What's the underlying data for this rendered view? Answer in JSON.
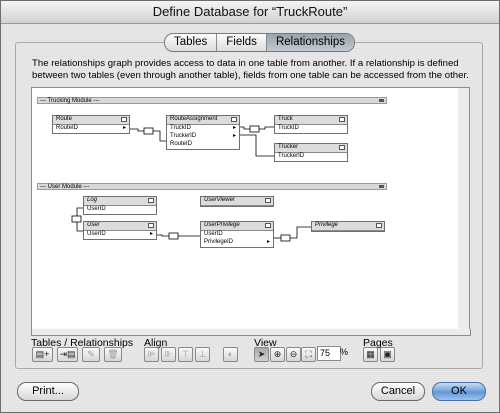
{
  "window": {
    "title": "Define Database for “TruckRoute”"
  },
  "tabs": [
    {
      "label": "Tables",
      "active": false
    },
    {
      "label": "Fields",
      "active": false
    },
    {
      "label": "Relationships",
      "active": true
    }
  ],
  "description": "The relationships graph provides access to data in one table from another. If a relationship is defined between two tables (even through another table), fields from one table can be accessed from the other.",
  "graph": {
    "modules": [
      {
        "label": "--- Trucking Module ---"
      },
      {
        "label": "--- User Module ---"
      }
    ],
    "tables": [
      {
        "name": "Route",
        "fields": [
          "RouteID"
        ],
        "italic": false
      },
      {
        "name": "RouteAssignment",
        "fields": [
          "TruckID",
          "TruckerID",
          "RouteID"
        ],
        "italic": false
      },
      {
        "name": "Truck",
        "fields": [
          "TruckID"
        ],
        "italic": false
      },
      {
        "name": "Trucker",
        "fields": [
          "TruckerID"
        ],
        "italic": false
      },
      {
        "name": "Log",
        "fields": [
          "UserID"
        ],
        "italic": true
      },
      {
        "name": "UserViewer",
        "fields": [],
        "italic": true
      },
      {
        "name": "User",
        "fields": [
          "UserID"
        ],
        "italic": true
      },
      {
        "name": "UserPrivilege",
        "fields": [
          "UserID",
          "PrivilegeID"
        ],
        "italic": true
      },
      {
        "name": "Privilege",
        "fields": [],
        "italic": true
      }
    ]
  },
  "toolbar": {
    "tables_relationships_label": "Tables / Relationships",
    "align_label": "Align",
    "view_label": "View",
    "pages_label": "Pages",
    "zoom_value": "75",
    "zoom_unit": "%"
  },
  "buttons": {
    "print": "Print...",
    "cancel": "Cancel",
    "ok": "OK"
  }
}
